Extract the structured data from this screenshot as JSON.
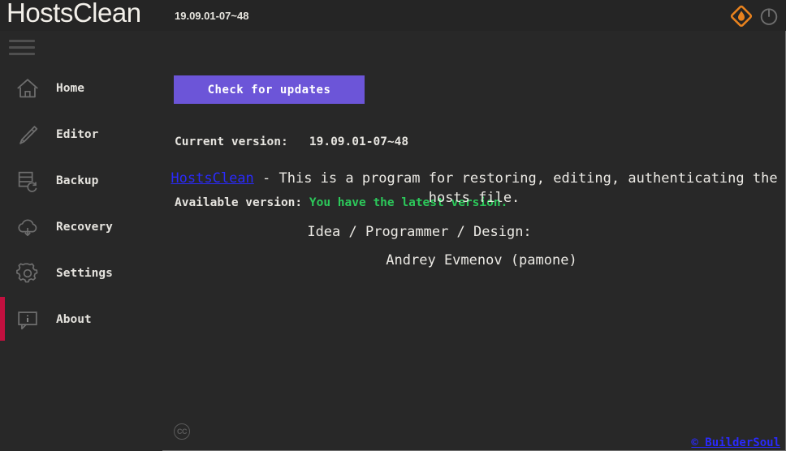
{
  "titlebar": {
    "app_title": "HostsClean",
    "version_short": "19.09.01-07~48",
    "logo_icon": "flame-diamond-logo-icon",
    "power_icon": "power-icon",
    "logo_color": "#e8821e",
    "power_color": "#6e6e6e"
  },
  "sidebar": {
    "menu_icon": "hamburger-menu-icon",
    "active_index": 5,
    "active_marker_color": "#c2103f",
    "items": [
      {
        "label": "Home",
        "icon": "home-icon"
      },
      {
        "label": "Editor",
        "icon": "pencil-icon"
      },
      {
        "label": "Backup",
        "icon": "database-refresh-icon"
      },
      {
        "label": "Recovery",
        "icon": "cloud-download-icon"
      },
      {
        "label": "Settings",
        "icon": "gear-icon"
      },
      {
        "label": "About",
        "icon": "info-bubble-icon"
      }
    ]
  },
  "updates": {
    "current_label": "Current version:",
    "current_value": "19.09.01-07~48",
    "available_label": "Available version:",
    "available_value": "You have the latest version.",
    "available_value_color": "#2cc85a",
    "check_button_label": "Check for updates",
    "check_button_color": "#6c55d8"
  },
  "about": {
    "app_link": "HostsClean",
    "description": "  - This is a program for restoring, editing, authenticating the hosts file.",
    "credits_role": "Idea / Programmer / Design:",
    "credits_name": "Andrey Evmenov (pamone)",
    "link_color": "#2a2afc"
  },
  "footer": {
    "cc_label": "CC",
    "cc_icon": "creative-commons-icon",
    "copyright_link": "© BuilderSoul"
  }
}
